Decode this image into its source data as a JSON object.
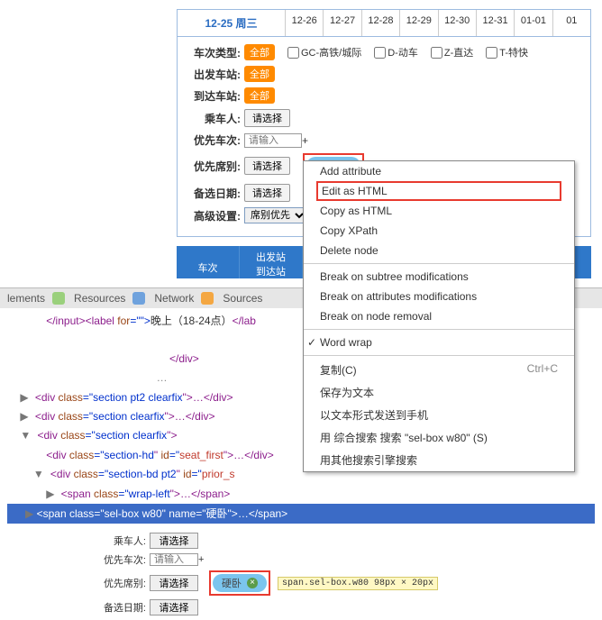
{
  "dateTabs": {
    "current": "12-25 周三",
    "others": [
      "12-26",
      "12-27",
      "12-28",
      "12-29",
      "12-30",
      "12-31",
      "01-01",
      "01"
    ]
  },
  "form": {
    "trainType": {
      "label": "车次类型:",
      "all": "全部",
      "opts": [
        "GC-高铁/城际",
        "D-动车",
        "Z-直达",
        "T-特快"
      ]
    },
    "fromStation": {
      "label": "出发车站:",
      "all": "全部"
    },
    "toStation": {
      "label": "到达车站:",
      "all": "全部"
    },
    "passenger": {
      "label": "乘车人:",
      "btn": "请选择"
    },
    "priorTrain": {
      "label": "优先车次:",
      "placeholder": "请输入"
    },
    "priorSeat": {
      "label": "优先席别:",
      "btn": "请选择",
      "pill": "硬卧",
      "tooltip": "span.sel-box.w80 98px × 20px"
    },
    "altDate": {
      "label": "备选日期:",
      "btn": "请选择"
    },
    "advanced": {
      "label": "高级设置:",
      "option": "席别优先"
    }
  },
  "blueBar": {
    "col1": "车次",
    "col2a": "出发站",
    "col2b": "到达站"
  },
  "devTabs": {
    "elements": "lements",
    "resources": "Resources",
    "network": "Network",
    "sources": "Sources"
  },
  "code": {
    "l1a": "</input>",
    "l1b": "<label ",
    "l1c": "for",
    "l1d": "=\"\">",
    "l1e": "晚上（18-24点）",
    "l1f": "</lab",
    "l2": "</div>",
    "l3a": "<div ",
    "l3b": "class",
    "l3c": "=\"",
    "l3d": "section pt2 clearfix",
    "l3e": "\">…</div>",
    "l4a": "<div ",
    "l4b": "class",
    "l4c": "=\"",
    "l4d": "section clearfix",
    "l4e": "\">…</div>",
    "l5a": "<div ",
    "l5b": "class",
    "l5c": "=\"",
    "l5d": "section clearfix",
    "l5e": "\">",
    "l6a": "<div ",
    "l6b": "class",
    "l6c": "=\"",
    "l6d": "section-hd",
    "l6e": "\" ",
    "l6f": "id",
    "l6g": "=\"",
    "l6h": "seat_first",
    "l6i": "\">…</div>",
    "l7a": "<div ",
    "l7b": "class",
    "l7c": "=\"",
    "l7d": "section-bd pt2",
    "l7e": "\" ",
    "l7f": "id",
    "l7g": "=\"",
    "l7h": "prior_s",
    "l8a": "<span ",
    "l8b": "class",
    "l8c": "=\"",
    "l8d": "wrap-left",
    "l8e": "\">…</span>",
    "l9a": "<span ",
    "l9b": "class",
    "l9c": "=\"",
    "l9d": "sel-box w80",
    "l9e": "\" ",
    "l9f": "name",
    "l9g": "=\"",
    "l9h": "硬卧",
    "l9i": "\">…</span>"
  },
  "mini": {
    "passenger": {
      "label": "乘车人:",
      "btn": "请选择"
    },
    "priorTrain": {
      "label": "优先车次:",
      "placeholder": "请输入"
    },
    "priorSeat": {
      "label": "优先席别:",
      "btn": "请选择",
      "pill": "硬卧",
      "tooltip": "span.sel-box.w80 98px × 20px"
    },
    "altDate": {
      "label": "备选日期:",
      "btn": "请选择"
    }
  },
  "ctx": {
    "addAttr": "Add attribute",
    "editHtml": "Edit as HTML",
    "copyHtml": "Copy as HTML",
    "copyXpath": "Copy XPath",
    "deleteNode": "Delete node",
    "brkSub": "Break on subtree modifications",
    "brkAttr": "Break on attributes modifications",
    "brkRem": "Break on node removal",
    "wordwrap": "Word wrap",
    "copyC": "复制(C)",
    "copyCKey": "Ctrl+C",
    "saveText": "保存为文本",
    "sendPhone": "以文本形式发送到手机",
    "searchComb": "用 综合搜索 搜索 \"sel-box w80\" (S)",
    "searchOther": "用其他搜索引擎搜索"
  }
}
